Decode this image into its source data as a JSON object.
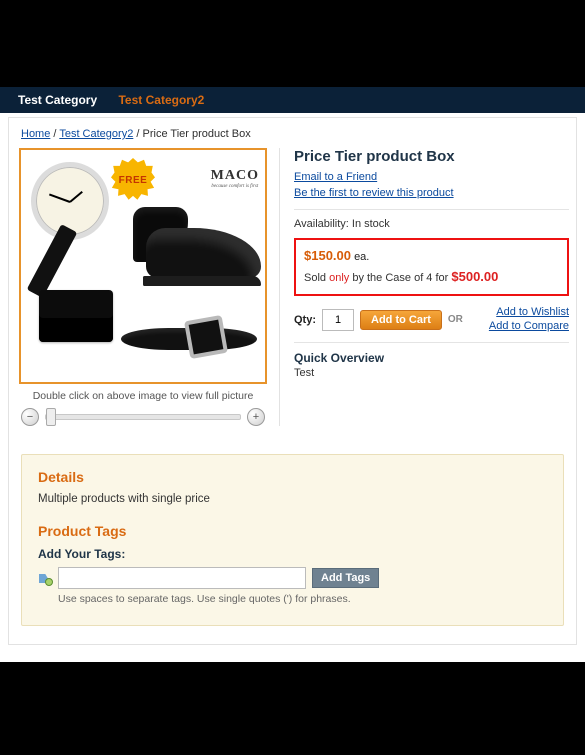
{
  "nav": {
    "cat1": "Test Category",
    "cat2": "Test Category2"
  },
  "breadcrumb": {
    "home": "Home",
    "cat": "Test Category2",
    "current": "Price Tier product Box",
    "sep": "/"
  },
  "image": {
    "hint": "Double click on above image to view full picture",
    "ribbon": "FREE",
    "brand": "MACO",
    "brand_tag": "because comfort is first",
    "zoom_out": "−",
    "zoom_in": "+"
  },
  "product": {
    "title": "Price Tier product Box",
    "email_friend": "Email to a Friend",
    "review_link": "Be the first to review this product",
    "avail_label": "Availability:",
    "avail_value": "In stock",
    "price_unit": "$150.00",
    "price_unit_suffix": "ea.",
    "case_prefix": "Sold ",
    "case_only": "only",
    "case_mid": " by the Case of 4 for ",
    "case_price": "$500.00",
    "qty_label": "Qty:",
    "qty_value": "1",
    "add_to_cart": "Add to Cart",
    "or": "OR",
    "wishlist": "Add to Wishlist",
    "compare": "Add to Compare",
    "qo_title": "Quick Overview",
    "qo_text": "Test"
  },
  "details": {
    "heading": "Details",
    "text": "Multiple products with single price"
  },
  "tags": {
    "heading": "Product Tags",
    "label": "Add Your Tags:",
    "button": "Add Tags",
    "help": "Use spaces to separate tags. Use single quotes (') for phrases."
  }
}
